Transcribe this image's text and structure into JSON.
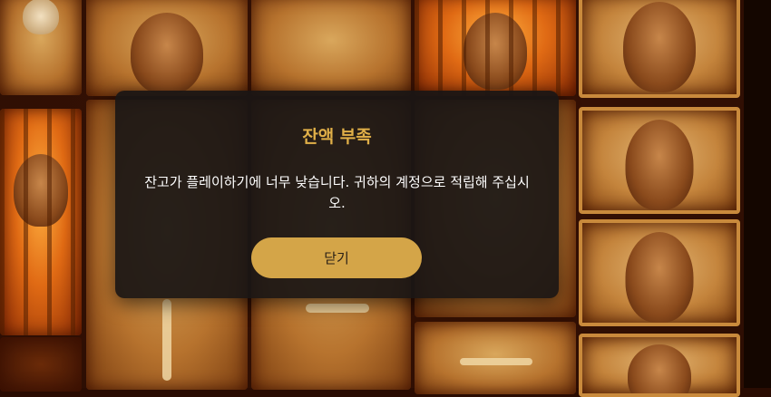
{
  "dialog": {
    "title": "잔액 부족",
    "message": "잔고가 플레이하기에 너무 낮습니다. 귀하의 계정으로 적립해 주십시오.",
    "close_label": "닫기"
  },
  "colors": {
    "accent": "#e1b048",
    "button": "#d4a548",
    "panel": "#1a1614"
  }
}
